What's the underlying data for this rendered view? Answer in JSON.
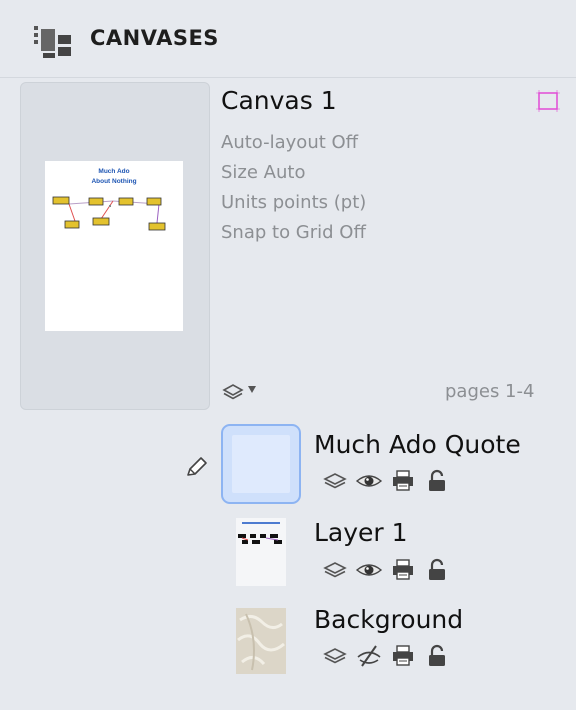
{
  "panel": {
    "title": "CANVASES",
    "icon": "canvases-icon"
  },
  "canvas": {
    "name": "Canvas 1",
    "properties": [
      "Auto-layout Off",
      "Size Auto",
      "Units points (pt)",
      "Snap to Grid Off"
    ],
    "pages": "pages 1-4",
    "thumbnail": {
      "title_line1": "Much Ado",
      "title_line2": "About Nothing"
    }
  },
  "layers": [
    {
      "name": "Much Ado Quote",
      "selected": true,
      "visible": true,
      "editing": true
    },
    {
      "name": "Layer 1",
      "selected": false,
      "visible": true
    },
    {
      "name": "Background",
      "selected": false,
      "visible": false
    }
  ],
  "colors": {
    "accent": "#8db4f2",
    "selection_fill": "#cfe0fb",
    "canvas_corner": "#e24bd6",
    "secondary_text": "#8c8f93"
  }
}
